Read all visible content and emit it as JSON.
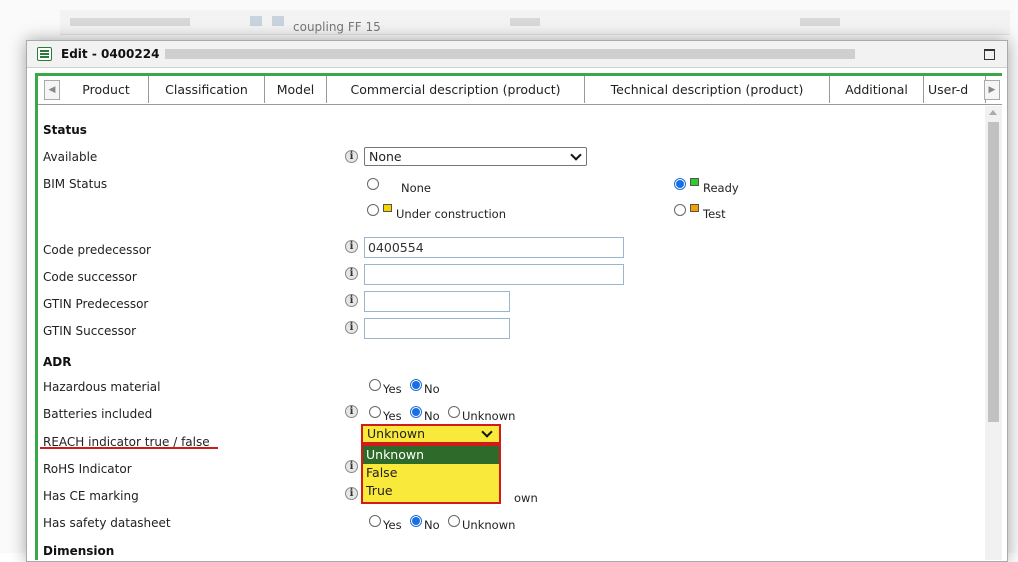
{
  "background": {
    "row_text": "coupling FF 15"
  },
  "dialog": {
    "title": "Edit - 0400224 "
  },
  "tabs": [
    {
      "label": "Product"
    },
    {
      "label": "Classification"
    },
    {
      "label": "Model"
    },
    {
      "label": "Commercial description (product)"
    },
    {
      "label": "Technical description (product)"
    },
    {
      "label": "Additional",
      "active": true
    },
    {
      "label": "User-d"
    }
  ],
  "form": {
    "status_heading": "Status",
    "available_label": "Available",
    "available_value": "None",
    "bim_label": "BIM Status",
    "bim_options": {
      "none": "None",
      "under_construction": "Under construction",
      "ready": "Ready",
      "test": "Test"
    },
    "bim_selected": "Ready",
    "code_predecessor_label": "Code predecessor",
    "code_predecessor_value": "0400554",
    "code_successor_label": "Code successor",
    "code_successor_value": "",
    "gtin_predecessor_label": "GTIN Predecessor",
    "gtin_successor_label": "GTIN Successor",
    "adr_heading": "ADR",
    "hazardous_label": "Hazardous material",
    "batteries_label": "Batteries included",
    "reach_label": "REACH indicator true / false",
    "reach_value": "Unknown",
    "reach_options": [
      "Unknown",
      "False",
      "True"
    ],
    "rohs_label": "RoHS Indicator",
    "ce_label": "Has CE marking",
    "safety_label": "Has safety datasheet",
    "dimension_heading": "Dimension",
    "yes": "Yes",
    "no": "No",
    "unknown": "Unknown",
    "ce_partial": "own"
  },
  "icons": {
    "info": "i"
  },
  "colors": {
    "ready_square": "#2ecc2e",
    "construction_square": "#f5d400",
    "test_square": "#f5a000",
    "highlight_yellow": "#f9e93a",
    "highlight_red": "#d21a1a",
    "frame_green": "#3aa848"
  }
}
